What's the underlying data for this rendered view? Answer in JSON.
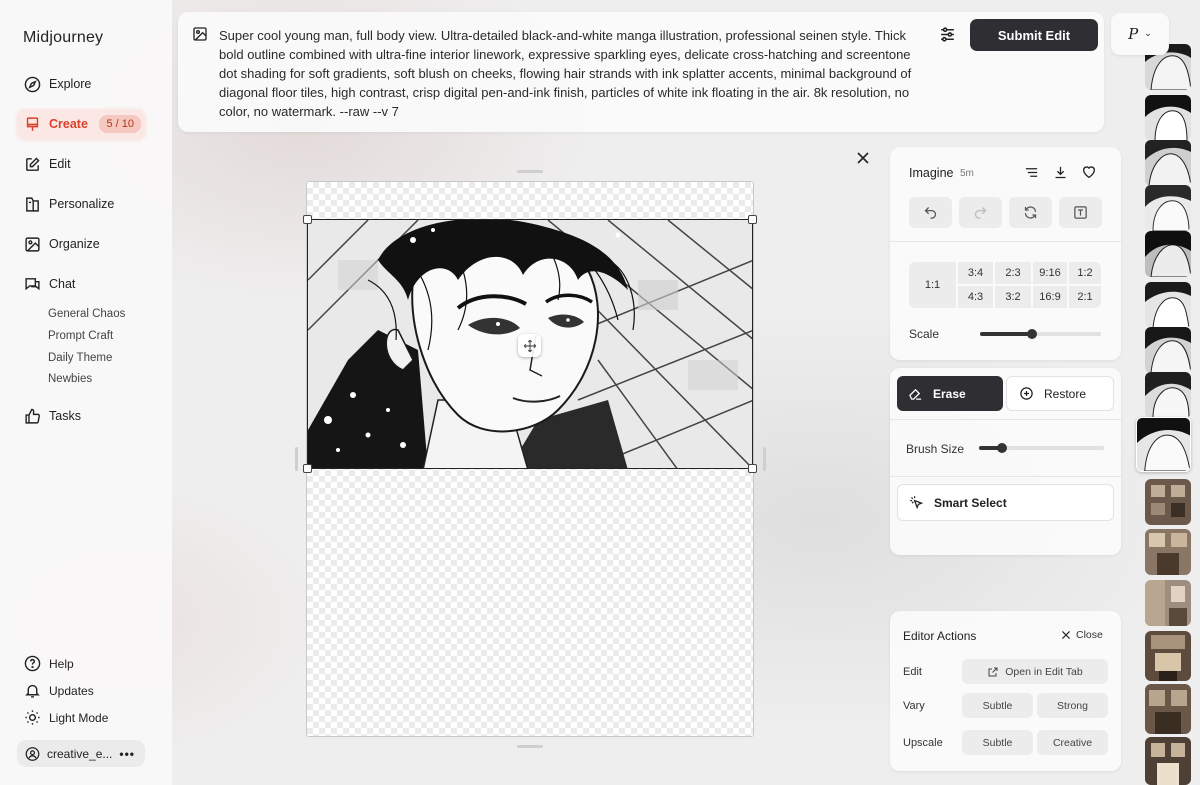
{
  "app": {
    "brand": "Midjourney"
  },
  "sidebar": {
    "nav": [
      {
        "label": "Explore",
        "icon": "compass-icon"
      },
      {
        "label": "Create",
        "icon": "brush-icon",
        "badge": "5 / 10",
        "active": true
      },
      {
        "label": "Edit",
        "icon": "edit-icon"
      },
      {
        "label": "Personalize",
        "icon": "personalize-icon"
      },
      {
        "label": "Organize",
        "icon": "image-icon"
      },
      {
        "label": "Chat",
        "icon": "chat-icon"
      }
    ],
    "chat_rooms": [
      "General Chaos",
      "Prompt Craft",
      "Daily Theme",
      "Newbies"
    ],
    "tasks": {
      "label": "Tasks",
      "icon": "thumbs-up-icon"
    },
    "bottom": [
      {
        "label": "Help",
        "icon": "help-icon"
      },
      {
        "label": "Updates",
        "icon": "bell-icon"
      },
      {
        "label": "Light Mode",
        "icon": "sun-icon"
      }
    ],
    "user": {
      "name": "creative_e...",
      "menu": "•••"
    }
  },
  "prompt": {
    "text": "Super cool young man, full body view. Ultra-detailed black-and-white manga illustration, professional seinen style. Thick bold outline combined with ultra-fine interior linework, expressive sparkling eyes, delicate cross-hatching and screentone dot shading for soft gradients, soft blush on cheeks, flowing hair strands with ink splatter accents, minimal background of diagonal floor tiles, high contrast, crisp digital pen-and-ink finish, particles of white ink floating in the air. 8k resolution, no color, no watermark. --raw --v 7",
    "submit_label": "Submit Edit",
    "profile_letter": "P"
  },
  "imagine_panel": {
    "title": "Imagine",
    "time": "5m",
    "ratios": [
      "1:1",
      "3:4",
      "2:3",
      "9:16",
      "1:2",
      "4:3",
      "3:2",
      "16:9",
      "2:1"
    ],
    "scale_label": "Scale",
    "scale_value": 0.43
  },
  "tool_panel": {
    "erase_label": "Erase",
    "restore_label": "Restore",
    "brush_label": "Brush Size",
    "brush_value": 0.18,
    "smart_select_label": "Smart Select"
  },
  "editor_actions": {
    "title": "Editor Actions",
    "close_label": "Close",
    "edit_label": "Edit",
    "open_tab_label": "Open in Edit Tab",
    "vary_label": "Vary",
    "vary_subtle": "Subtle",
    "vary_strong": "Strong",
    "upscale_label": "Upscale",
    "upscale_subtle": "Subtle",
    "upscale_creative": "Creative"
  },
  "colors": {
    "accent": "#d9412a",
    "badge_bg": "#f6c9c0",
    "dark_button": "#2f2f33"
  }
}
